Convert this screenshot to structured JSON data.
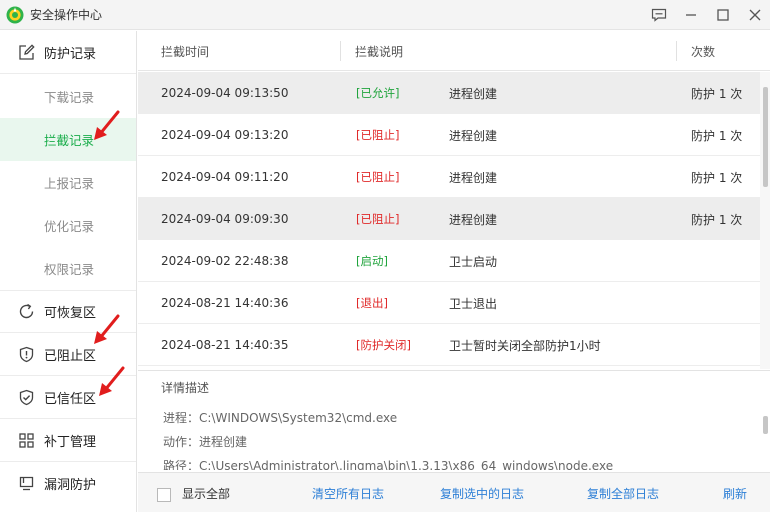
{
  "window": {
    "title": "安全操作中心",
    "controls": [
      "feedback-icon",
      "minimize-icon",
      "maximize-icon",
      "close-icon"
    ]
  },
  "sidebar": {
    "main_items": [
      {
        "label": "防护记录",
        "icon": "edit-icon"
      },
      {
        "label": "可恢复区",
        "icon": "restore-icon"
      },
      {
        "label": "已阻止区",
        "icon": "shield-alert-icon"
      },
      {
        "label": "已信任区",
        "icon": "shield-check-icon"
      },
      {
        "label": "补丁管理",
        "icon": "grid-icon"
      },
      {
        "label": "漏洞防护",
        "icon": "monitor-icon"
      }
    ],
    "sub_items": [
      {
        "label": "下载记录"
      },
      {
        "label": "拦截记录",
        "active": true
      },
      {
        "label": "上报记录"
      },
      {
        "label": "优化记录"
      },
      {
        "label": "权限记录"
      }
    ],
    "accent_color": "#1aad4b",
    "arrow_color": "#e11d1d"
  },
  "table": {
    "headers": {
      "time": "拦截时间",
      "desc": "拦截说明",
      "count": "次数"
    },
    "rows": [
      {
        "time": "2024-09-04 09:13:50",
        "tag": "[已允许]",
        "tag_color": "green",
        "desc": "进程创建",
        "count": "防护 1 次",
        "selected": true
      },
      {
        "time": "2024-09-04 09:13:20",
        "tag": "[已阻止]",
        "tag_color": "red",
        "desc": "进程创建",
        "count": "防护 1 次"
      },
      {
        "time": "2024-09-04 09:11:20",
        "tag": "[已阻止]",
        "tag_color": "red",
        "desc": "进程创建",
        "count": "防护 1 次"
      },
      {
        "time": "2024-09-04 09:09:30",
        "tag": "[已阻止]",
        "tag_color": "red",
        "desc": "进程创建",
        "count": "防护 1 次",
        "selected": true
      },
      {
        "time": "2024-09-02 22:48:38",
        "tag": "[启动]",
        "tag_color": "green",
        "desc": "卫士启动",
        "count": ""
      },
      {
        "time": "2024-08-21 14:40:36",
        "tag": "[退出]",
        "tag_color": "red",
        "desc": "卫士退出",
        "count": ""
      },
      {
        "time": "2024-08-21 14:40:35",
        "tag": "[防护关闭]",
        "tag_color": "red",
        "desc": "卫士暂时关闭全部防护1小时",
        "count": ""
      }
    ]
  },
  "detail": {
    "title": "详情描述",
    "lines": [
      "进程：C:\\WINDOWS\\System32\\cmd.exe",
      "动作：进程创建",
      "路径：C:\\Users\\Administrator\\.lingma\\bin\\1.3.13\\x86_64_windows\\node.exe"
    ]
  },
  "footer": {
    "show_all_label": "显示全部",
    "show_all_checked": false,
    "clear_logs": "清空所有日志",
    "copy_selected": "复制选中的日志",
    "copy_all": "复制全部日志",
    "refresh": "刷新",
    "link_color": "#2d7fd6"
  }
}
